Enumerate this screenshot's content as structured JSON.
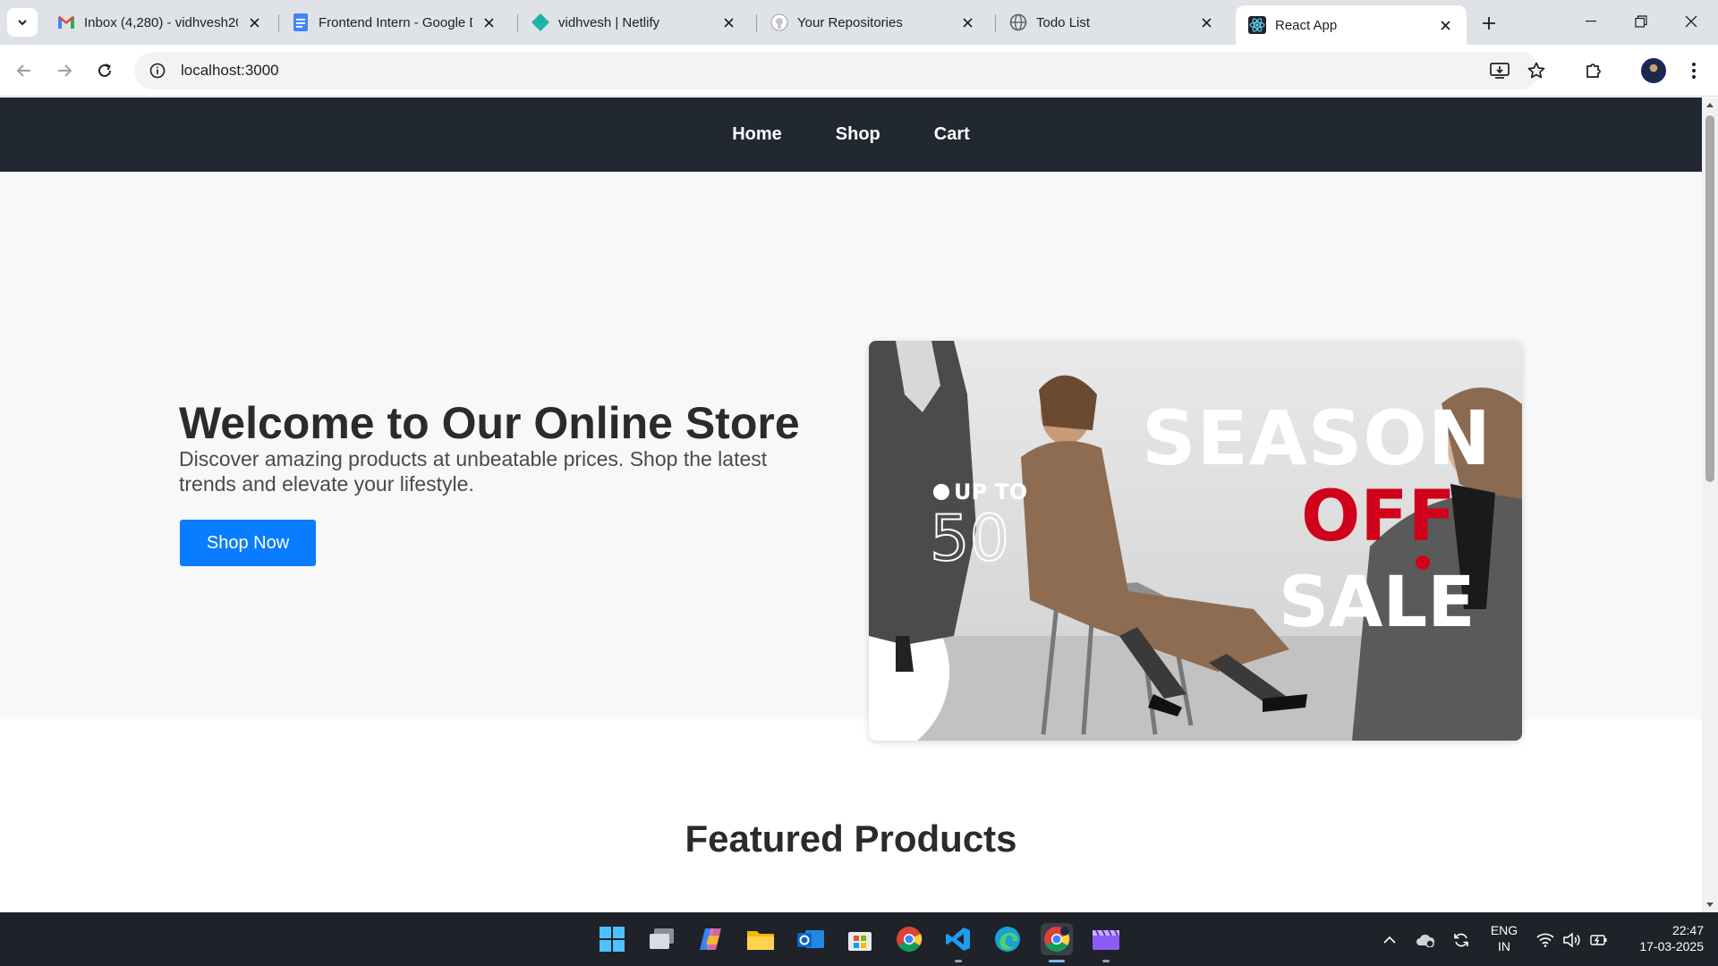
{
  "browser": {
    "tabs": [
      {
        "title": "Inbox (4,280) - vidhvesh20",
        "icon": "gmail-icon",
        "active": false
      },
      {
        "title": "Frontend Intern - Google D",
        "icon": "google-docs-icon",
        "active": false
      },
      {
        "title": "vidhvesh | Netlify",
        "icon": "netlify-icon",
        "active": false
      },
      {
        "title": "Your Repositories",
        "icon": "github-icon",
        "active": false
      },
      {
        "title": "Todo List",
        "icon": "globe-icon",
        "active": false
      },
      {
        "title": "React App",
        "icon": "react-icon",
        "active": true
      }
    ],
    "url": "localhost:3000"
  },
  "site": {
    "nav": {
      "home": "Home",
      "shop": "Shop",
      "cart": "Cart"
    },
    "hero": {
      "title": "Welcome to Our Online Store",
      "text": "Discover amazing products at unbeatable prices. Shop the latest trends and elevate your lifestyle.",
      "button": "Shop Now"
    },
    "banner": {
      "up_to": "UP TO",
      "numbers": "50",
      "season": "SEASON",
      "off": "OFF",
      "sale": "SALE"
    },
    "featured_title": "Featured Products"
  },
  "taskbar": {
    "language": "ENG",
    "region": "IN",
    "time": "22:47",
    "date": "17-03-2025"
  },
  "colors": {
    "nav_bg": "#222831",
    "accent": "#0a7cff",
    "sale_red": "#d0021b"
  }
}
